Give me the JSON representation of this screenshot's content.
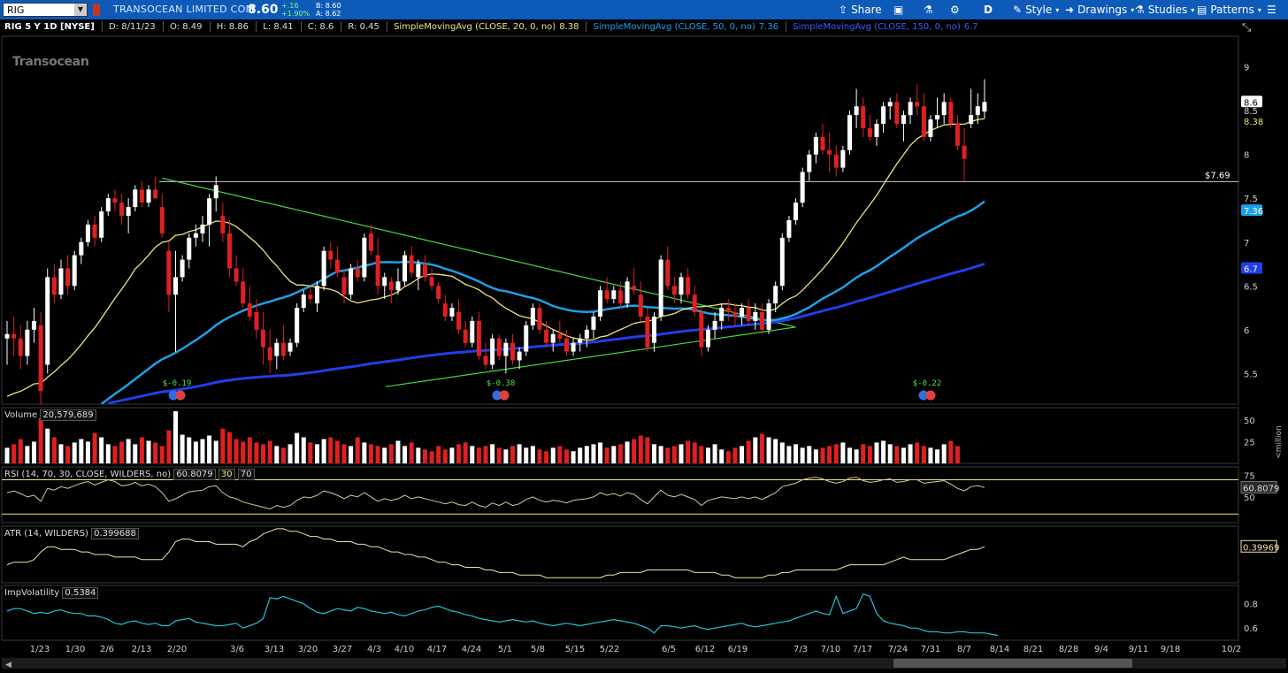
{
  "toolbar": {
    "symbol": "RIG",
    "company": "TRANSOCEAN LIMITED COM",
    "last": "8.60",
    "change": "+.16",
    "change_pct": "+1.90%",
    "bid": "B: 8.60",
    "ask": "A: 8.62",
    "share": "Share",
    "aggregation": "D",
    "style": "Style",
    "drawings": "Drawings",
    "studies": "Studies",
    "patterns": "Patterns"
  },
  "header": {
    "title": "RIG 5 Y 1D [NYSE]",
    "date": "D: 8/11/23",
    "open": "O: 8.49",
    "high": "H: 8.86",
    "low": "L: 8.41",
    "close": "C: 8.6",
    "range": "R: 0.45",
    "sma20_label": "SimpleMovingAvg (CLOSE, 20, 0, no)",
    "sma20_value": "8.38",
    "sma50_label": "SimpleMovingAvg (CLOSE, 50, 0, no)",
    "sma50_value": "7.36",
    "sma150_label": "SimpleMovingAvg (CLOSE, 150, 0, no)",
    "sma150_value": "6.7"
  },
  "watermark": "Transocean",
  "colors": {
    "up": "#ffffff",
    "down": "#e02020",
    "sma20": "#f2e37a",
    "sma50": "#1ea0e6",
    "sma150": "#1f3fe8",
    "trendline": "#45d845",
    "rsi": "#d8c8a0",
    "atr": "#f4e1b0",
    "iv": "#22c0d8",
    "toolbar": "#0d5ab8"
  },
  "price_axis": {
    "ticks": [
      "9",
      "8.5",
      "8",
      "7.5",
      "7",
      "6.5",
      "6",
      "5.5"
    ],
    "last_tag": "8.6",
    "sma20_tag": "8.38",
    "sma50_tag": "7.36",
    "sma150_tag": "6.7",
    "level_label": "$7.69"
  },
  "dividends": [
    "$-0.19",
    "$-0.38",
    "$-0.22"
  ],
  "volume": {
    "label": "Volume",
    "value": "20,579,689",
    "ticks": [
      "50",
      "25"
    ],
    "unit": "<million"
  },
  "rsi": {
    "label": "RSI (14, 70, 30, CLOSE, WILDERS, no)",
    "value": "60.8079",
    "ob": "30",
    "os": "70",
    "ticks": [
      "75",
      "50"
    ],
    "tag": "60.8079"
  },
  "atr": {
    "label": "ATR (14, WILDERS)",
    "value": "0.399688",
    "tag": "0.39969"
  },
  "iv": {
    "label": "ImpVolatility",
    "value": "0.5384",
    "ticks": [
      "0.8",
      "0.6"
    ]
  },
  "xaxis": {
    "ticks": [
      "1/23",
      "1/30",
      "2/6",
      "2/13",
      "2/20",
      "3/6",
      "3/13",
      "3/20",
      "3/27",
      "4/3",
      "4/10",
      "4/17",
      "4/24",
      "5/1",
      "5/8",
      "5/15",
      "5/22",
      "6/5",
      "6/12",
      "6/19",
      "7/3",
      "7/10",
      "7/17",
      "7/24",
      "7/31",
      "8/7",
      "8/14",
      "8/21",
      "8/28",
      "9/4",
      "9/11",
      "9/18",
      "10/2"
    ]
  },
  "chart_data": {
    "type": "candlestick",
    "title": "RIG 5 Y 1D [NYSE]",
    "ylim": [
      5.15,
      9.35
    ],
    "candles": [
      [
        5.9,
        6.1,
        5.6,
        5.95
      ],
      [
        5.95,
        6.15,
        5.7,
        5.9
      ],
      [
        5.9,
        6.05,
        5.55,
        5.7
      ],
      [
        5.7,
        6.1,
        5.6,
        6.0
      ],
      [
        6.0,
        6.25,
        5.85,
        6.1
      ],
      [
        6.05,
        6.2,
        5.15,
        5.3
      ],
      [
        5.6,
        6.7,
        5.5,
        6.6
      ],
      [
        6.6,
        6.75,
        6.3,
        6.4
      ],
      [
        6.4,
        6.8,
        6.35,
        6.7
      ],
      [
        6.7,
        6.85,
        6.4,
        6.5
      ],
      [
        6.5,
        6.9,
        6.45,
        6.85
      ],
      [
        6.85,
        7.05,
        6.75,
        7.0
      ],
      [
        7.0,
        7.25,
        6.95,
        7.2
      ],
      [
        7.2,
        7.3,
        6.95,
        7.05
      ],
      [
        7.05,
        7.4,
        7.0,
        7.35
      ],
      [
        7.35,
        7.55,
        7.3,
        7.5
      ],
      [
        7.5,
        7.6,
        7.35,
        7.45
      ],
      [
        7.45,
        7.55,
        7.2,
        7.3
      ],
      [
        7.3,
        7.5,
        7.1,
        7.4
      ],
      [
        7.4,
        7.65,
        7.35,
        7.6
      ],
      [
        7.6,
        7.7,
        7.4,
        7.45
      ],
      [
        7.45,
        7.65,
        7.4,
        7.6
      ],
      [
        7.6,
        7.75,
        7.5,
        7.5
      ],
      [
        7.4,
        7.55,
        7.05,
        7.1
      ],
      [
        6.9,
        7.0,
        6.2,
        6.4
      ],
      [
        6.4,
        6.9,
        5.75,
        6.6
      ],
      [
        6.6,
        6.85,
        6.55,
        6.8
      ],
      [
        6.8,
        7.1,
        6.7,
        7.05
      ],
      [
        7.05,
        7.2,
        6.95,
        7.1
      ],
      [
        7.1,
        7.3,
        7.0,
        7.2
      ],
      [
        7.2,
        7.55,
        6.95,
        7.5
      ],
      [
        7.5,
        7.75,
        7.35,
        7.65
      ],
      [
        7.3,
        7.45,
        7.0,
        7.1
      ],
      [
        7.1,
        7.25,
        6.6,
        6.7
      ],
      [
        6.7,
        6.85,
        6.5,
        6.55
      ],
      [
        6.55,
        6.7,
        6.25,
        6.3
      ],
      [
        6.3,
        6.5,
        6.1,
        6.15
      ],
      [
        6.2,
        6.35,
        5.9,
        6.0
      ],
      [
        6.0,
        6.2,
        5.6,
        5.8
      ],
      [
        5.8,
        6.0,
        5.5,
        5.65
      ],
      [
        5.7,
        5.9,
        5.55,
        5.85
      ],
      [
        5.85,
        6.05,
        5.65,
        5.7
      ],
      [
        5.75,
        5.9,
        5.7,
        5.85
      ],
      [
        5.85,
        6.3,
        5.8,
        6.25
      ],
      [
        6.25,
        6.45,
        6.2,
        6.4
      ],
      [
        6.4,
        6.5,
        6.3,
        6.35
      ],
      [
        6.3,
        6.55,
        6.2,
        6.5
      ],
      [
        6.5,
        6.95,
        6.45,
        6.9
      ],
      [
        6.9,
        7.0,
        6.7,
        6.8
      ],
      [
        6.8,
        6.95,
        6.6,
        6.65
      ],
      [
        6.6,
        6.7,
        6.3,
        6.4
      ],
      [
        6.4,
        6.75,
        6.35,
        6.7
      ],
      [
        6.7,
        6.8,
        6.55,
        6.6
      ],
      [
        6.6,
        7.1,
        6.55,
        7.05
      ],
      [
        7.1,
        7.2,
        6.85,
        6.9
      ],
      [
        6.85,
        7.05,
        6.4,
        6.5
      ],
      [
        6.5,
        6.65,
        6.35,
        6.6
      ],
      [
        6.55,
        6.6,
        6.3,
        6.45
      ],
      [
        6.45,
        6.7,
        6.4,
        6.55
      ],
      [
        6.55,
        6.9,
        6.5,
        6.85
      ],
      [
        6.85,
        6.95,
        6.6,
        6.65
      ],
      [
        6.6,
        6.8,
        6.45,
        6.75
      ],
      [
        6.75,
        6.85,
        6.55,
        6.6
      ],
      [
        6.6,
        6.7,
        6.45,
        6.5
      ],
      [
        6.5,
        6.55,
        6.3,
        6.35
      ],
      [
        6.3,
        6.4,
        6.1,
        6.15
      ],
      [
        6.15,
        6.3,
        6.1,
        6.25
      ],
      [
        6.2,
        6.35,
        5.95,
        6.0
      ],
      [
        6.0,
        6.1,
        5.8,
        5.85
      ],
      [
        5.85,
        6.15,
        5.8,
        6.1
      ],
      [
        6.1,
        6.2,
        5.65,
        5.7
      ],
      [
        5.7,
        5.85,
        5.55,
        5.6
      ],
      [
        5.6,
        5.95,
        5.55,
        5.9
      ],
      [
        5.9,
        5.95,
        5.65,
        5.7
      ],
      [
        5.7,
        5.9,
        5.5,
        5.85
      ],
      [
        5.85,
        5.95,
        5.6,
        5.65
      ],
      [
        5.65,
        5.8,
        5.55,
        5.75
      ],
      [
        5.75,
        6.1,
        5.7,
        6.05
      ],
      [
        6.05,
        6.3,
        6.0,
        6.25
      ],
      [
        6.25,
        6.3,
        5.95,
        6.0
      ],
      [
        6.0,
        6.1,
        5.8,
        5.85
      ],
      [
        5.85,
        6.0,
        5.75,
        5.95
      ],
      [
        5.95,
        6.1,
        5.85,
        5.9
      ],
      [
        5.9,
        6.0,
        5.7,
        5.75
      ],
      [
        5.75,
        5.9,
        5.7,
        5.85
      ],
      [
        5.85,
        5.95,
        5.75,
        5.9
      ],
      [
        5.9,
        6.05,
        5.8,
        6.0
      ],
      [
        6.0,
        6.2,
        5.9,
        6.15
      ],
      [
        6.15,
        6.5,
        6.1,
        6.45
      ],
      [
        6.45,
        6.6,
        6.3,
        6.35
      ],
      [
        6.35,
        6.5,
        6.3,
        6.45
      ],
      [
        6.45,
        6.55,
        6.25,
        6.3
      ],
      [
        6.3,
        6.6,
        6.25,
        6.55
      ],
      [
        6.5,
        6.7,
        6.4,
        6.45
      ],
      [
        6.4,
        6.55,
        6.1,
        6.15
      ],
      [
        6.15,
        6.25,
        5.75,
        5.8
      ],
      [
        5.85,
        6.2,
        5.75,
        6.15
      ],
      [
        6.15,
        6.85,
        6.1,
        6.8
      ],
      [
        6.8,
        6.95,
        6.45,
        6.5
      ],
      [
        6.5,
        6.6,
        6.3,
        6.4
      ],
      [
        6.4,
        6.65,
        6.3,
        6.6
      ],
      [
        6.6,
        6.7,
        6.35,
        6.4
      ],
      [
        6.4,
        6.5,
        6.15,
        6.2
      ],
      [
        6.2,
        6.25,
        5.7,
        5.8
      ],
      [
        5.8,
        6.05,
        5.75,
        6.0
      ],
      [
        6.0,
        6.2,
        5.9,
        6.1
      ],
      [
        6.1,
        6.3,
        6.0,
        6.25
      ],
      [
        6.25,
        6.35,
        6.1,
        6.2
      ],
      [
        6.2,
        6.3,
        6.05,
        6.15
      ],
      [
        6.15,
        6.3,
        6.05,
        6.25
      ],
      [
        6.25,
        6.35,
        6.05,
        6.1
      ],
      [
        6.1,
        6.3,
        6.0,
        6.2
      ],
      [
        6.2,
        6.3,
        5.95,
        6.0
      ],
      [
        6.0,
        6.35,
        5.95,
        6.3
      ],
      [
        6.3,
        6.55,
        6.2,
        6.5
      ],
      [
        6.5,
        7.1,
        6.45,
        7.05
      ],
      [
        7.05,
        7.3,
        7.0,
        7.25
      ],
      [
        7.25,
        7.5,
        7.2,
        7.45
      ],
      [
        7.45,
        7.85,
        7.4,
        7.8
      ],
      [
        7.8,
        8.05,
        7.7,
        8.0
      ],
      [
        8.0,
        8.25,
        7.9,
        8.2
      ],
      [
        8.2,
        8.35,
        8.0,
        8.05
      ],
      [
        8.05,
        8.25,
        7.8,
        8.0
      ],
      [
        8.0,
        8.1,
        7.75,
        7.85
      ],
      [
        7.85,
        8.1,
        7.8,
        8.05
      ],
      [
        8.05,
        8.5,
        8.0,
        8.45
      ],
      [
        8.45,
        8.75,
        8.3,
        8.55
      ],
      [
        8.55,
        8.65,
        8.2,
        8.3
      ],
      [
        8.3,
        8.45,
        8.15,
        8.2
      ],
      [
        8.2,
        8.4,
        8.1,
        8.35
      ],
      [
        8.35,
        8.6,
        8.25,
        8.55
      ],
      [
        8.55,
        8.65,
        8.4,
        8.6
      ],
      [
        8.6,
        8.7,
        8.3,
        8.35
      ],
      [
        8.35,
        8.5,
        8.15,
        8.45
      ],
      [
        8.45,
        8.65,
        8.35,
        8.6
      ],
      [
        8.6,
        8.8,
        8.45,
        8.55
      ],
      [
        8.55,
        8.7,
        8.15,
        8.2
      ],
      [
        8.2,
        8.45,
        8.15,
        8.4
      ],
      [
        8.4,
        8.65,
        8.3,
        8.45
      ],
      [
        8.45,
        8.7,
        8.35,
        8.6
      ],
      [
        8.6,
        8.65,
        8.3,
        8.35
      ],
      [
        8.35,
        8.45,
        8.05,
        8.1
      ],
      [
        8.1,
        8.3,
        7.7,
        7.95
      ],
      [
        8.35,
        8.75,
        8.3,
        8.45
      ],
      [
        8.45,
        8.7,
        8.35,
        8.55
      ],
      [
        8.49,
        8.86,
        8.41,
        8.6
      ]
    ],
    "volume_millions": [
      18,
      22,
      28,
      20,
      25,
      52,
      40,
      30,
      22,
      20,
      24,
      28,
      25,
      35,
      30,
      22,
      20,
      25,
      28,
      22,
      30,
      26,
      24,
      20,
      38,
      60,
      33,
      30,
      25,
      28,
      32,
      26,
      40,
      36,
      28,
      25,
      30,
      24,
      22,
      26,
      20,
      18,
      22,
      35,
      30,
      24,
      22,
      28,
      30,
      26,
      22,
      20,
      30,
      24,
      22,
      20,
      18,
      22,
      26,
      20,
      24,
      18,
      16,
      14,
      20,
      16,
      18,
      22,
      24,
      20,
      18,
      20,
      22,
      18,
      16,
      20,
      22,
      18,
      20,
      16,
      14,
      18,
      20,
      16,
      14,
      18,
      20,
      22,
      24,
      18,
      20,
      22,
      25,
      28,
      32,
      30,
      22,
      20,
      18,
      20,
      22,
      26,
      24,
      20,
      18,
      22,
      16,
      14,
      18,
      20,
      26,
      30,
      34,
      30,
      28,
      24,
      20,
      22,
      18,
      20,
      16,
      18,
      20,
      22,
      24,
      18,
      16,
      22,
      20,
      24,
      26,
      22,
      20,
      18,
      22,
      24,
      20,
      18,
      16,
      22,
      26,
      20
    ],
    "rsi": [
      55,
      57,
      54,
      50,
      52,
      45,
      60,
      58,
      62,
      60,
      63,
      66,
      68,
      64,
      67,
      70,
      68,
      63,
      64,
      67,
      63,
      65,
      62,
      55,
      45,
      48,
      52,
      56,
      57,
      58,
      62,
      63,
      55,
      50,
      48,
      44,
      42,
      40,
      38,
      36,
      40,
      38,
      40,
      46,
      50,
      49,
      52,
      57,
      55,
      52,
      48,
      52,
      50,
      55,
      50,
      45,
      48,
      46,
      48,
      52,
      48,
      50,
      48,
      46,
      44,
      42,
      44,
      41,
      40,
      44,
      40,
      38,
      43,
      40,
      44,
      40,
      42,
      47,
      50,
      46,
      44,
      46,
      45,
      43,
      46,
      47,
      48,
      50,
      55,
      52,
      54,
      51,
      55,
      53,
      47,
      42,
      50,
      58,
      52,
      50,
      53,
      50,
      47,
      40,
      46,
      48,
      50,
      49,
      48,
      50,
      48,
      50,
      47,
      51,
      55,
      62,
      64,
      66,
      70,
      72,
      73,
      71,
      68,
      66,
      68,
      72,
      73,
      69,
      67,
      68,
      70,
      71,
      67,
      68,
      70,
      70,
      66,
      67,
      68,
      69,
      65,
      60,
      57,
      62,
      63,
      61
    ],
    "atr": [
      0.33,
      0.34,
      0.34,
      0.34,
      0.35,
      0.38,
      0.4,
      0.4,
      0.39,
      0.39,
      0.39,
      0.38,
      0.38,
      0.37,
      0.37,
      0.37,
      0.36,
      0.36,
      0.36,
      0.36,
      0.35,
      0.35,
      0.35,
      0.35,
      0.38,
      0.42,
      0.43,
      0.43,
      0.42,
      0.42,
      0.42,
      0.41,
      0.41,
      0.41,
      0.41,
      0.4,
      0.42,
      0.43,
      0.45,
      0.46,
      0.47,
      0.47,
      0.46,
      0.46,
      0.45,
      0.44,
      0.44,
      0.43,
      0.43,
      0.42,
      0.42,
      0.42,
      0.41,
      0.41,
      0.4,
      0.4,
      0.39,
      0.38,
      0.38,
      0.37,
      0.37,
      0.36,
      0.36,
      0.35,
      0.34,
      0.34,
      0.33,
      0.33,
      0.32,
      0.32,
      0.32,
      0.31,
      0.31,
      0.3,
      0.3,
      0.3,
      0.29,
      0.29,
      0.29,
      0.29,
      0.28,
      0.28,
      0.28,
      0.28,
      0.28,
      0.28,
      0.28,
      0.28,
      0.28,
      0.29,
      0.29,
      0.3,
      0.3,
      0.3,
      0.3,
      0.31,
      0.31,
      0.31,
      0.31,
      0.31,
      0.31,
      0.31,
      0.3,
      0.3,
      0.3,
      0.3,
      0.29,
      0.29,
      0.28,
      0.28,
      0.28,
      0.28,
      0.28,
      0.29,
      0.29,
      0.3,
      0.3,
      0.31,
      0.31,
      0.31,
      0.31,
      0.31,
      0.31,
      0.31,
      0.32,
      0.33,
      0.33,
      0.33,
      0.33,
      0.33,
      0.33,
      0.34,
      0.35,
      0.36,
      0.35,
      0.35,
      0.35,
      0.35,
      0.35,
      0.35,
      0.36,
      0.37,
      0.38,
      0.39,
      0.39,
      0.4
    ],
    "iv": [
      0.74,
      0.76,
      0.76,
      0.74,
      0.72,
      0.73,
      0.72,
      0.74,
      0.75,
      0.73,
      0.72,
      0.72,
      0.7,
      0.7,
      0.69,
      0.67,
      0.64,
      0.63,
      0.65,
      0.66,
      0.64,
      0.63,
      0.64,
      0.62,
      0.62,
      0.66,
      0.67,
      0.68,
      0.65,
      0.64,
      0.63,
      0.62,
      0.62,
      0.63,
      0.64,
      0.6,
      0.62,
      0.64,
      0.68,
      0.85,
      0.84,
      0.86,
      0.84,
      0.82,
      0.8,
      0.76,
      0.73,
      0.72,
      0.74,
      0.76,
      0.75,
      0.74,
      0.77,
      0.76,
      0.74,
      0.73,
      0.72,
      0.73,
      0.71,
      0.7,
      0.72,
      0.74,
      0.75,
      0.77,
      0.78,
      0.76,
      0.74,
      0.73,
      0.71,
      0.7,
      0.68,
      0.67,
      0.66,
      0.65,
      0.66,
      0.67,
      0.66,
      0.65,
      0.66,
      0.64,
      0.63,
      0.62,
      0.63,
      0.64,
      0.63,
      0.62,
      0.63,
      0.64,
      0.65,
      0.66,
      0.67,
      0.66,
      0.65,
      0.64,
      0.62,
      0.6,
      0.56,
      0.62,
      0.62,
      0.61,
      0.6,
      0.61,
      0.62,
      0.6,
      0.59,
      0.6,
      0.61,
      0.62,
      0.63,
      0.64,
      0.62,
      0.61,
      0.62,
      0.63,
      0.64,
      0.65,
      0.66,
      0.68,
      0.7,
      0.72,
      0.74,
      0.72,
      0.71,
      0.86,
      0.72,
      0.74,
      0.76,
      0.88,
      0.86,
      0.72,
      0.66,
      0.64,
      0.63,
      0.62,
      0.6,
      0.6,
      0.58,
      0.57,
      0.57,
      0.56,
      0.56,
      0.57,
      0.57,
      0.56,
      0.56,
      0.56,
      0.55,
      0.54
    ]
  }
}
